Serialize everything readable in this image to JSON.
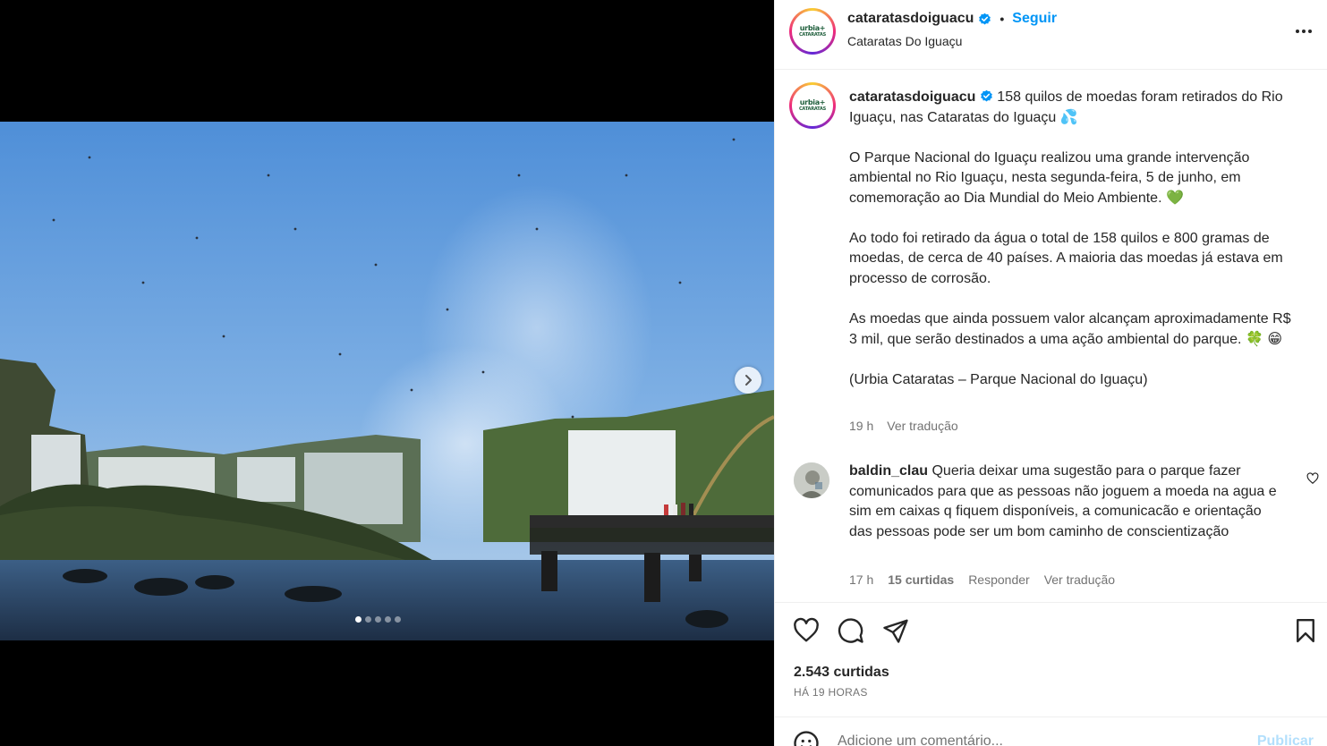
{
  "post": {
    "account": "cataratasdoiguacu",
    "location": "Cataratas Do Iguaçu",
    "follow_label": "Seguir",
    "separator": "•",
    "avatar_logo_line1": "urbia+",
    "avatar_logo_line2": "CATARATAS"
  },
  "media": {
    "slide_count": 5,
    "active_slide": 1
  },
  "caption": {
    "username": "cataratasdoiguacu",
    "paragraphs": [
      "158 quilos de moedas foram retirados do Rio Iguaçu, nas Cataratas do Iguaçu 💦",
      "O Parque Nacional do Iguaçu realizou uma grande intervenção ambiental no Rio Iguaçu, nesta segunda-feira, 5 de junho, em comemoração ao Dia Mundial do Meio Ambiente. 💚",
      "Ao todo foi retirado da água o total de 158 quilos e 800 gramas de moedas, de cerca de 40 países. A maioria das moedas já estava em processo de corrosão.",
      "As moedas que ainda possuem valor alcançam aproximadamente R$ 3 mil, que serão destinados a uma ação ambiental do parque. 🍀 😁",
      "(Urbia Cataratas – Parque Nacional do Iguaçu)"
    ],
    "age": "19 h",
    "translate_label": "Ver tradução"
  },
  "comment": {
    "username": "baldin_clau",
    "text": "Queria deixar uma sugestão para o parque fazer comunicados para que as pessoas não joguem a moeda na agua e sim em caixas q fiquem disponíveis, a comunicacão e orientação das pessoas pode ser um bom caminho de conscientização",
    "age": "17 h",
    "likes": "15 curtidas",
    "reply_label": "Responder",
    "translate_label": "Ver tradução"
  },
  "footer": {
    "likes": "2.543 curtidas",
    "time_ago": "HÁ 19 HORAS",
    "comment_placeholder": "Adicione um comentário...",
    "post_label": "Publicar"
  },
  "colors": {
    "accent": "#0095f6",
    "text": "#262626",
    "secondary": "#737373",
    "post_disabled": "#b2dffc"
  }
}
